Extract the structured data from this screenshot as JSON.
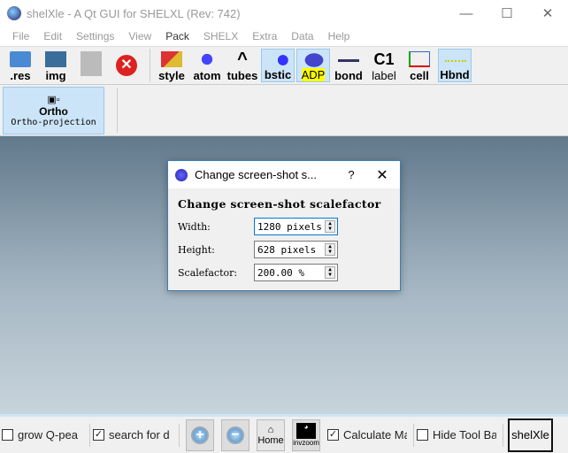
{
  "window": {
    "title": "shelXle - A Qt GUI for SHELXL (Rev: 742)",
    "minimize": "—",
    "maximize": "☐",
    "close": "✕"
  },
  "menu": [
    "File",
    "Edit",
    "Settings",
    "View",
    "Pack",
    "SHELX",
    "Extra",
    "Data",
    "Help"
  ],
  "toolbar": {
    "file_buttons": [
      ".res",
      "img",
      "",
      ""
    ],
    "view_buttons": [
      {
        "label": "style",
        "on": false
      },
      {
        "label": "atom",
        "on": false
      },
      {
        "label": "tubes",
        "on": false
      },
      {
        "label": "bstic",
        "on": true
      },
      {
        "label": "ADP",
        "on": true
      },
      {
        "label": "bond",
        "on": false
      },
      {
        "label": "label",
        "on": false
      },
      {
        "label": "cell",
        "on": false
      },
      {
        "label": "Hbnd",
        "on": true
      }
    ],
    "label_glyph": "C1"
  },
  "toolbar2": {
    "ortho_label": "Ortho",
    "ortho_sub": "Ortho-projection"
  },
  "dialog": {
    "title": "Change screen-shot s...",
    "help": "?",
    "close": "✕",
    "heading": "Change screen-shot scalefactor",
    "fields": [
      {
        "label": "Width:",
        "value": "1280 pixels"
      },
      {
        "label": "Height:",
        "value": "628 pixels"
      },
      {
        "label": "Scalefactor:",
        "value": "200.00 %"
      }
    ]
  },
  "status": {
    "grow": "grow Q-pea",
    "search": "search for d",
    "home": "Home",
    "invzoom": "invzoom",
    "calc": "Calculate Ma",
    "hide": "Hide Tool Ba",
    "shelxle": "shelXle",
    "check": "✓"
  }
}
